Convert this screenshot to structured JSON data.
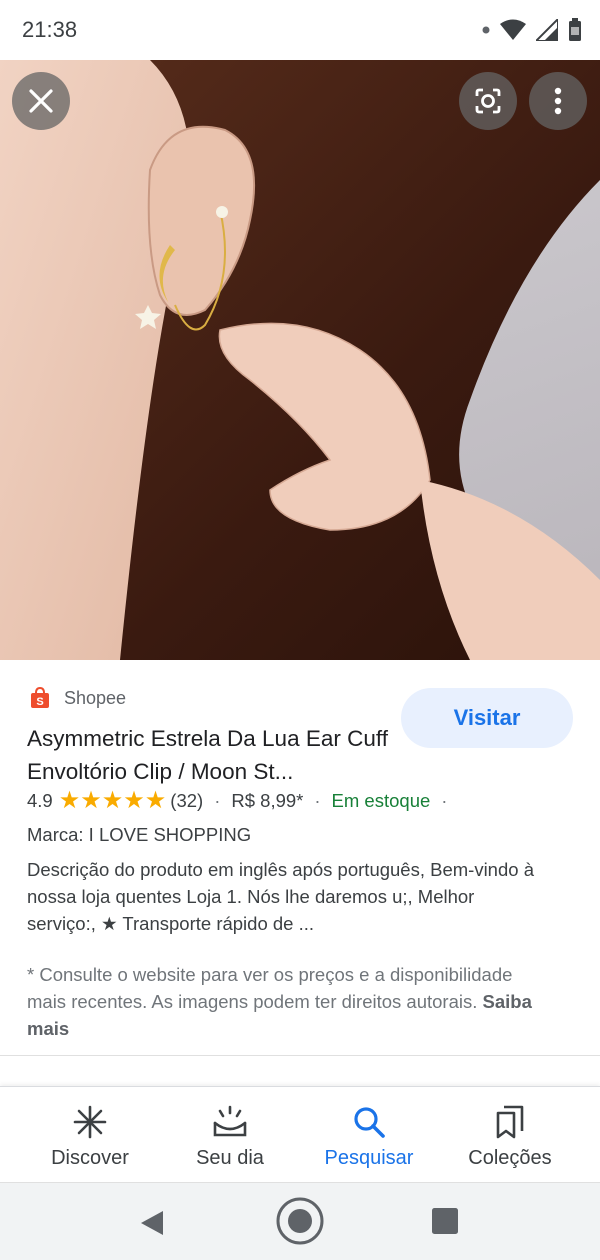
{
  "status_bar": {
    "time": "21:38",
    "icons": [
      "dot-icon",
      "wifi-icon",
      "signal-icon",
      "battery-icon"
    ]
  },
  "image_viewer": {
    "close_icon": "close-icon",
    "lens_icon": "lens-icon",
    "more_icon": "more-vert-icon"
  },
  "product": {
    "source": "Shopee",
    "source_icon": "shopee-bag-icon",
    "visit_label": "Visitar",
    "title": "Asymmetric Estrela Da Lua Ear Cuff Envoltório Clip / Moon St...",
    "rating": "4.9",
    "stars": 5,
    "review_count": "(32)",
    "separator": "·",
    "price": "R$ 8,99*",
    "availability": "Em estoque",
    "brand": "Marca: I LOVE SHOPPING",
    "description": "Descrição do produto em inglês após português, Bem-vindo à nossa loja quentes Loja 1. Nós lhe daremos u;, Melhor serviço:, ★ Transporte rápido de ...",
    "disclaimer": "* Consulte o website para ver os preços e a disponibilidade mais recentes. As imagens podem ter direitos autorais.",
    "learn_more": "Saiba mais"
  },
  "bottom_nav": {
    "items": [
      {
        "label": "Discover",
        "icon": "asterisk-icon"
      },
      {
        "label": "Seu dia",
        "icon": "sunrise-icon"
      },
      {
        "label": "Pesquisar",
        "icon": "search-icon"
      },
      {
        "label": "Coleções",
        "icon": "bookmarks-icon"
      }
    ],
    "active": "Pesquisar"
  },
  "colors": {
    "accent": "#1a73e8",
    "stock_green": "#188038",
    "star": "#f9ab00",
    "shopee": "#ee4d2d"
  }
}
